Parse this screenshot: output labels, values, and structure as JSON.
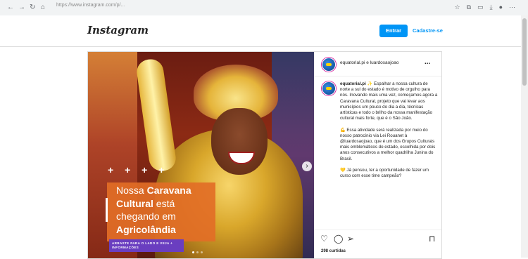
{
  "browser": {
    "url": "https://www.instagram.com/p/...",
    "nav": [
      "←",
      "→",
      "↻",
      "⌂"
    ],
    "toolbar_icons": [
      "star-icon",
      "extensions-icon",
      "menu-icon"
    ]
  },
  "header": {
    "logo": "Instagram",
    "login_label": "Entrar",
    "signup_label": "Cadastre-se"
  },
  "post": {
    "media": {
      "stars": "+ + + +",
      "banner_line1_plain": "Nossa ",
      "banner_line1_bold": "Caravana",
      "banner_line2_bold": "Cultural",
      "banner_line2_plain": " está",
      "banner_line3_plain": "chegando em",
      "banner_line4_bold": "Agricolândia",
      "cta": "ARRASTE PARA O LADO E VEJA + INFORMAÇÕES",
      "next_arrow": "›"
    },
    "header_user": "equatorial.pi e luardosaojoao",
    "more_label": "...",
    "caption": {
      "user": "equatorial.pi",
      "p1": " ✨ Espalhar a nossa cultura de norte a sul do estado é motivo de orgulho para nós. Inovando mais uma vez, começamos agora a Caravana Cultural, projeto que vai levar aos municípios um pouco do dia a dia, técnicas artísticas e todo o brilho da nossa manifestação cultural mais forte, que é o São João.",
      "p2": "💪 Essa atividade será realizada por meio do nosso patrocínio via Lei Rouanet à @luardosaojoao, que é um dos Grupos Culturais mais emblemáticos do estado, escolhida por dois anos consecutivos a melhor quadrilha Junina do Brasil.",
      "p3": "💛 Já pensou, ter a oportunidade de fazer um curso com esse time campeão?"
    },
    "likes": "298 curtidas"
  }
}
